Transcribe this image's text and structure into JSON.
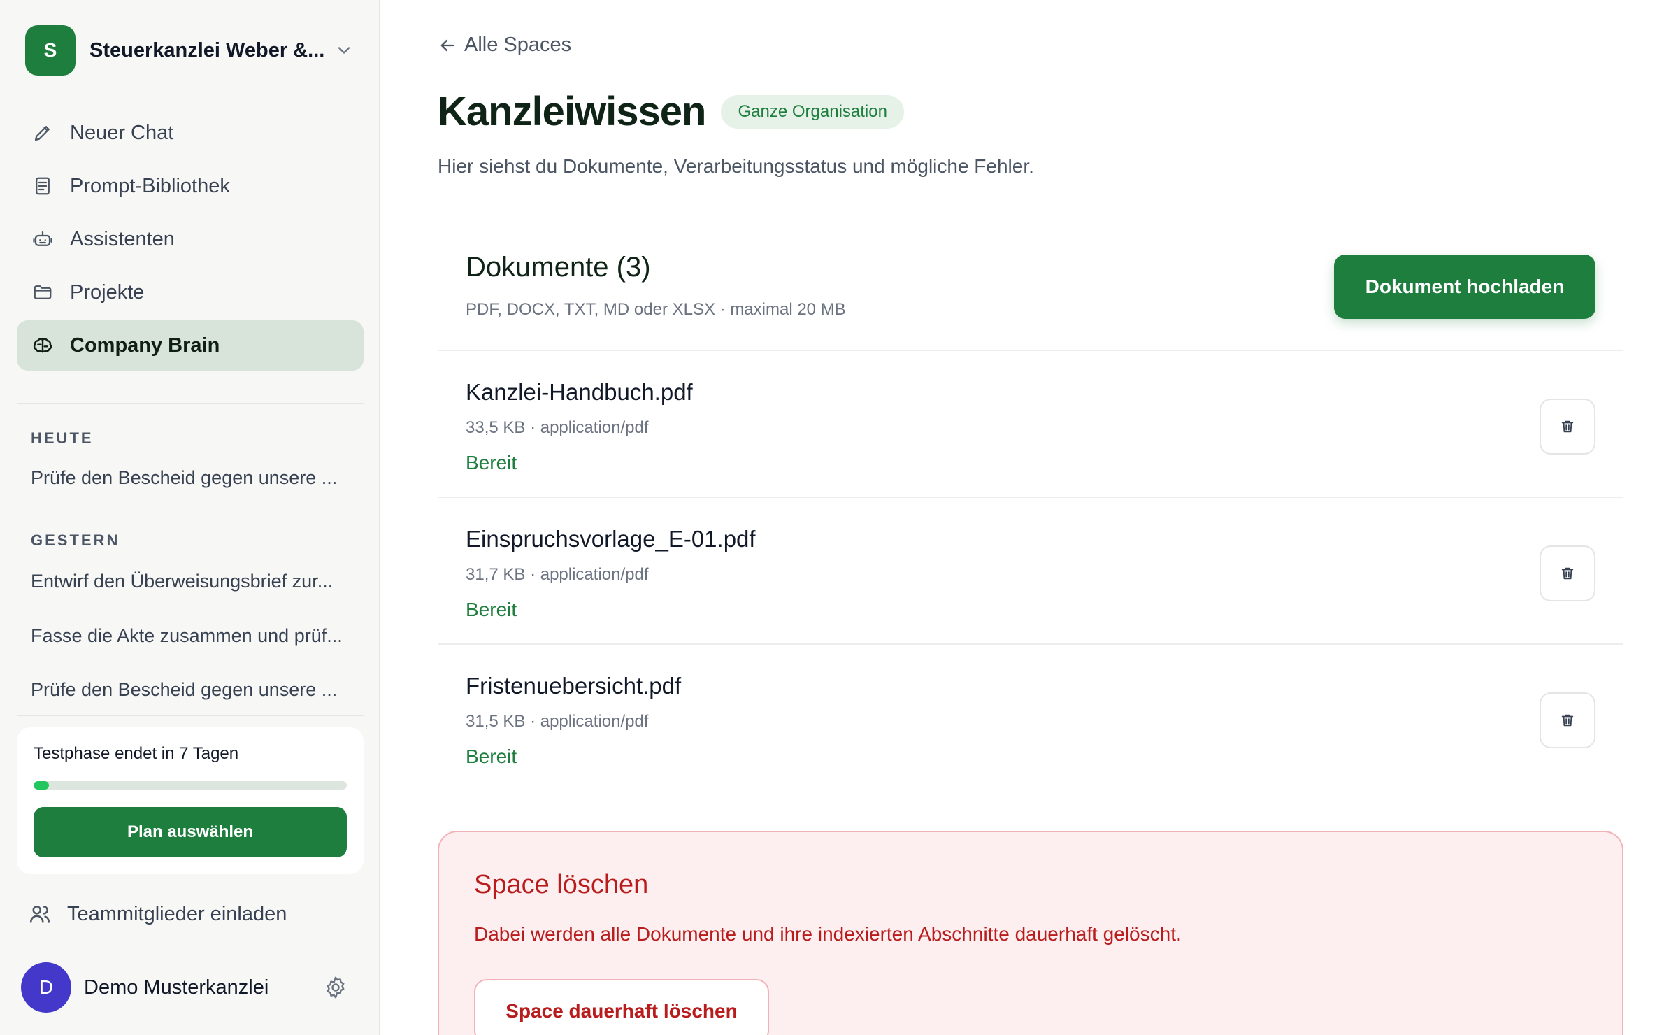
{
  "sidebar": {
    "org": {
      "initial": "S",
      "name": "Steuerkanzlei Weber &..."
    },
    "nav": [
      {
        "label": "Neuer Chat",
        "icon": "pencil-icon"
      },
      {
        "label": "Prompt-Bibliothek",
        "icon": "document-icon"
      },
      {
        "label": "Assistenten",
        "icon": "robot-icon"
      },
      {
        "label": "Projekte",
        "icon": "folder-icon"
      },
      {
        "label": "Company Brain",
        "icon": "brain-icon",
        "active": true
      }
    ],
    "history": {
      "today_label": "HEUTE",
      "today": [
        "Prüfe den Bescheid gegen unsere ..."
      ],
      "yesterday_label": "GESTERN",
      "yesterday": [
        "Entwirf den Überweisungsbrief zur...",
        "Fasse die Akte zusammen und prüf...",
        "Prüfe den Bescheid gegen unsere ..."
      ]
    },
    "trial": {
      "text": "Testphase endet in 7 Tagen",
      "progress": 0.05,
      "button": "Plan auswählen"
    },
    "invite_label": "Teammitglieder einladen",
    "user": {
      "initial": "D",
      "name": "Demo Musterkanzlei"
    }
  },
  "main": {
    "back_label": "Alle Spaces",
    "title": "Kanzleiwissen",
    "badge": "Ganze Organisation",
    "subtitle": "Hier siehst du Dokumente, Verarbeitungsstatus und mögliche Fehler.",
    "documents": {
      "heading": "Dokumente (3)",
      "hint": "PDF, DOCX, TXT, MD oder XLSX · maximal 20 MB",
      "upload_button": "Dokument hochladen",
      "items": [
        {
          "name": "Kanzlei-Handbuch.pdf",
          "meta": "33,5 KB · application/pdf",
          "status": "Bereit"
        },
        {
          "name": "Einspruchsvorlage_E-01.pdf",
          "meta": "31,7 KB · application/pdf",
          "status": "Bereit"
        },
        {
          "name": "Fristenuebersicht.pdf",
          "meta": "31,5 KB · application/pdf",
          "status": "Bereit"
        }
      ]
    },
    "danger": {
      "title": "Space löschen",
      "text": "Dabei werden alle Dokumente und ihre indexierten Abschnitte dauerhaft gelöscht.",
      "button": "Space dauerhaft löschen"
    }
  },
  "colors": {
    "brand": "#1e7e3e",
    "danger": "#b91c1c",
    "active_nav": "#d8e3da"
  }
}
